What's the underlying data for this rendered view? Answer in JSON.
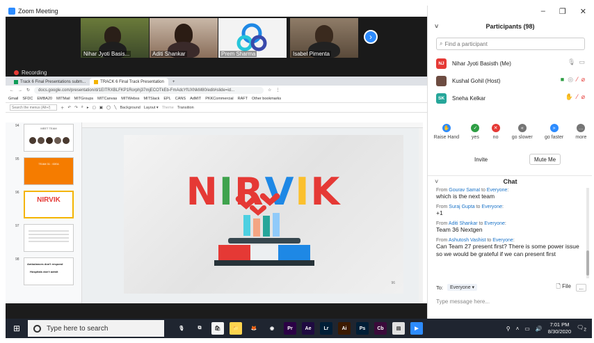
{
  "zoom": {
    "window_title": "Zoom Meeting",
    "recording_label": "Recording",
    "tiles": [
      {
        "name": "Nihar Jyoti Basis..."
      },
      {
        "name": "Aditi Shankar"
      },
      {
        "name": "Prem Sharma"
      },
      {
        "name": "Isabel Pimenta"
      }
    ],
    "next_icon": "chevron-right-icon"
  },
  "browser": {
    "tabs": [
      {
        "label": "Track 6 Final Presentations subm..."
      },
      {
        "label": "TRACK 6 Final Track Presentation"
      }
    ],
    "new_tab": "+",
    "url": "docs.google.com/presentation/d/1EITRXBLFKP1Rorphj37mjECOTkEb-FmAdcYfUXNkM80/edit#slide=id...",
    "bookmarks": [
      "Gmail",
      "SFDC",
      "EMBA20",
      "MITMail",
      "MITGroups",
      "MITCanvas",
      "MITWebss",
      "MITSlack",
      "EPL",
      "CANS",
      "AdMIT",
      "PKKCommercial",
      "RAFT",
      "Other bookmarks"
    ],
    "menu_search_placeholder": "Search the menus (Alt+/)",
    "toolbar": {
      "background": "Background",
      "layout": "Layout ▾",
      "theme": "Theme",
      "transition": "Transition"
    }
  },
  "slides": {
    "thumb_numbers": [
      "94",
      "95",
      "96",
      "97",
      "98"
    ],
    "thumb_texts": {
      "t94": "MEET TEAM",
      "t95": "TEAM 31 : IDEA",
      "t96": "NIRVIK",
      "t98a": "Ambulances don't respond",
      "t98b": "Hospitals don't admit"
    },
    "current_title": "NIRVIK",
    "page_number": "96",
    "title_colors": [
      "#e53935",
      "#3fa34d",
      "#e53935",
      "#1e88e5",
      "#fbc02d",
      "#e53935"
    ]
  },
  "taskbar": {
    "search_placeholder": "Type here to search",
    "apps": [
      {
        "label": "Pr",
        "color": "#2b0045"
      },
      {
        "label": "Ae",
        "color": "#1f0a40"
      },
      {
        "label": "Lr",
        "color": "#001e36"
      },
      {
        "label": "Ai",
        "color": "#3b1a00"
      },
      {
        "label": "Ps",
        "color": "#001e36"
      },
      {
        "label": "Cb",
        "color": "#3a0a3a"
      }
    ],
    "time": "7:01 PM",
    "date": "8/30/2020",
    "notification_count": "2"
  },
  "participants": {
    "header": "Participants (98)",
    "find_placeholder": "Find a participant",
    "list": [
      {
        "initials": "NJ",
        "name": "Nihar Jyoti Basisth (Me)",
        "color": "#e53935"
      },
      {
        "initials": "",
        "name": "Kushal Gohil (Host)",
        "color": "#6d4c41"
      },
      {
        "initials": "SK",
        "name": "Sneha Kelkar",
        "color": "#26a69a"
      }
    ],
    "reactions": [
      {
        "label": "Raise Hand",
        "color": "#2d8cff",
        "glyph": "✋"
      },
      {
        "label": "yes",
        "color": "#2e9e44",
        "glyph": "✓"
      },
      {
        "label": "no",
        "color": "#e53935",
        "glyph": "✕"
      },
      {
        "label": "go slower",
        "color": "#757575",
        "glyph": "«"
      },
      {
        "label": "go faster",
        "color": "#2d8cff",
        "glyph": "»"
      },
      {
        "label": "more",
        "color": "#757575",
        "glyph": "…"
      }
    ],
    "invite_label": "Invite",
    "mute_me_label": "Mute Me"
  },
  "chat": {
    "header": "Chat",
    "messages": [
      {
        "sender": "Gourav Samal",
        "to": "Everyone",
        "text": "which is the next team"
      },
      {
        "sender": "Suraj Gupta",
        "to": "Everyone",
        "text": "+1"
      },
      {
        "sender": "Aditi Shankar",
        "to": "Everyone",
        "text": "Team 36 Nextgen"
      },
      {
        "sender": "Ashutosh Vashist",
        "to": "Everyone",
        "text": "Can Team 27 present first? There is some power issue so we would be grateful if we can present first"
      }
    ],
    "from_word": "From",
    "to_word": "to",
    "to_label": "To:",
    "to_value": "Everyone ▾",
    "file_label": "File",
    "more_label": "...",
    "input_placeholder": "Type message here..."
  }
}
